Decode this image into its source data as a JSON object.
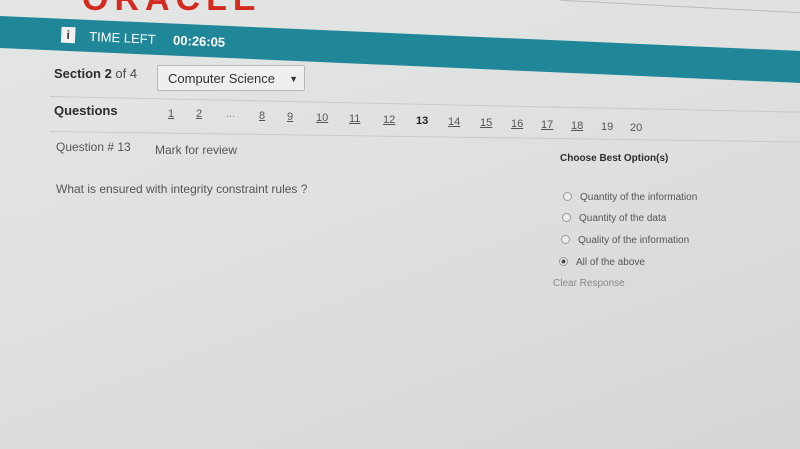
{
  "header": {
    "logo_text": "ORACLE"
  },
  "timer": {
    "label": "TIME LEFT",
    "value": "00:26:05"
  },
  "section": {
    "label": "Section 2",
    "of_text": "of 4",
    "selected_subject": "Computer Science"
  },
  "questions_nav": {
    "label": "Questions",
    "numbers": [
      "1",
      "2",
      "8",
      "9",
      "10",
      "11",
      "12",
      "13",
      "14",
      "15",
      "16",
      "17",
      "18",
      "19",
      "20"
    ],
    "current": "13",
    "ellipsis": "..."
  },
  "question": {
    "number_text": "Question # 13",
    "mark_review": "Mark for review",
    "text": "What is ensured with integrity constraint rules ?"
  },
  "options": {
    "heading": "Choose Best Option(s)",
    "items": [
      {
        "label": "Quantity of the information",
        "selected": false
      },
      {
        "label": "Quantity of the data",
        "selected": false
      },
      {
        "label": "Quality of the information",
        "selected": false
      },
      {
        "label": "All of the above",
        "selected": true
      }
    ],
    "clear_label": "Clear Response"
  }
}
